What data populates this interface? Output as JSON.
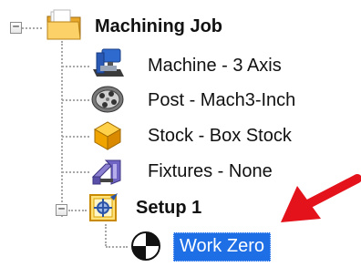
{
  "tree": {
    "root": {
      "label": "Machining Job",
      "icon": "folder-icon",
      "expanded": true
    },
    "children": [
      {
        "label": "Machine - 3 Axis",
        "icon": "machine-icon"
      },
      {
        "label": "Post - Mach3-Inch",
        "icon": "post-icon"
      },
      {
        "label": "Stock - Box Stock",
        "icon": "stock-icon"
      },
      {
        "label": "Fixtures - None",
        "icon": "fixtures-icon"
      }
    ],
    "setup": {
      "label": "Setup 1",
      "icon": "setup-icon",
      "expanded": true,
      "children": [
        {
          "label": "Work Zero",
          "icon": "work-zero-icon",
          "selected": true
        }
      ]
    }
  },
  "toggle_glyph": "−",
  "annotation": {
    "type": "arrow",
    "color": "#e3121b",
    "points_to": "Work Zero"
  },
  "colors": {
    "selection": "#1e6ee6",
    "arrow": "#e3121b"
  }
}
